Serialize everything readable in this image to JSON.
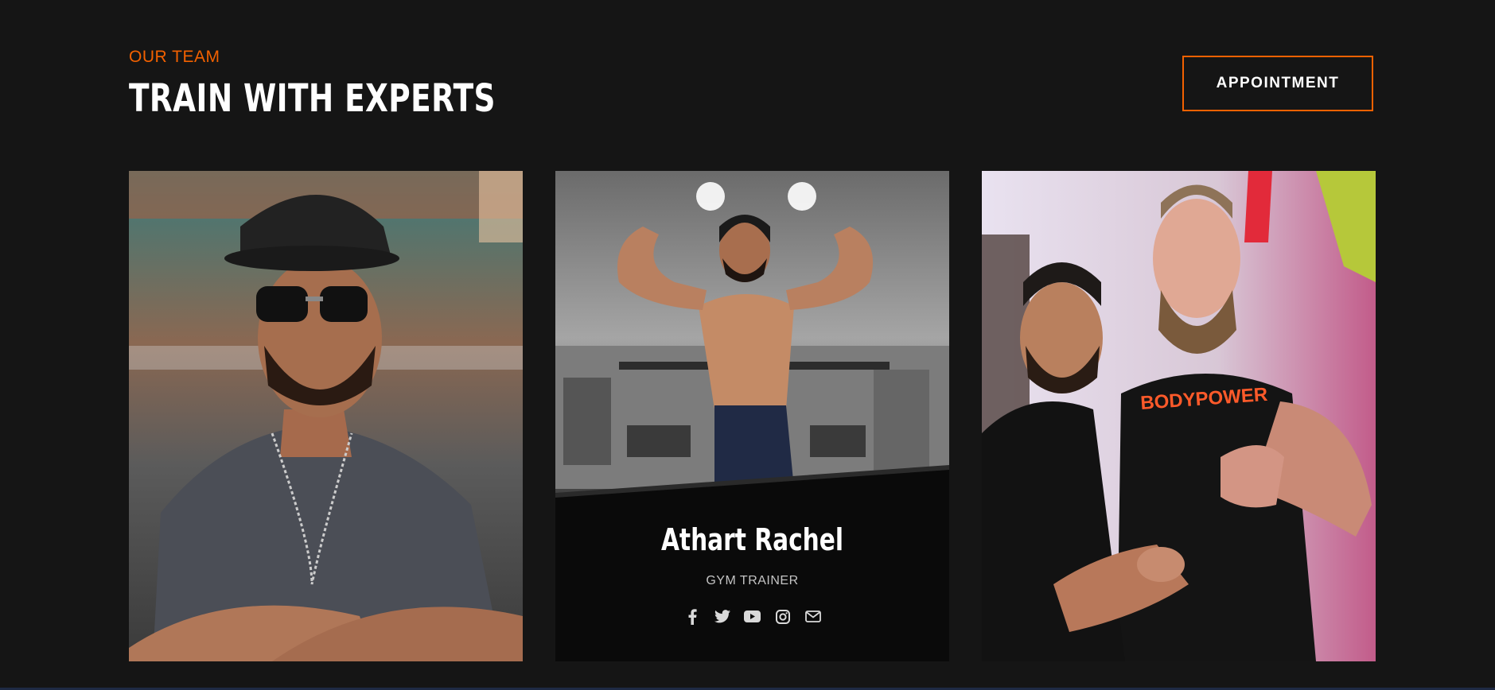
{
  "header": {
    "kicker": "OUR TEAM",
    "title": "TRAIN WITH EXPERTS",
    "appointment_label": "APPOINTMENT"
  },
  "team": [
    {
      "name": "",
      "role": "",
      "photo": "trainer-cap-sunglasses"
    },
    {
      "name": "Athart Rachel",
      "role": "GYM TRAINER",
      "photo": "trainer-flexing"
    },
    {
      "name": "",
      "role": "",
      "photo": "trainers-bodypower"
    }
  ],
  "featured_card": {
    "name": "Athart Rachel",
    "role": "GYM TRAINER",
    "social_icons": [
      "facebook-icon",
      "twitter-icon",
      "youtube-icon",
      "instagram-icon",
      "envelope-icon"
    ]
  },
  "photo_text": {
    "shirt_logo": "BODYPOWER"
  },
  "colors": {
    "accent": "#f36100",
    "background": "#151515",
    "card_caption": "#0a0a0a",
    "title": "#ffffff",
    "subtitle": "#c4c4c4"
  }
}
